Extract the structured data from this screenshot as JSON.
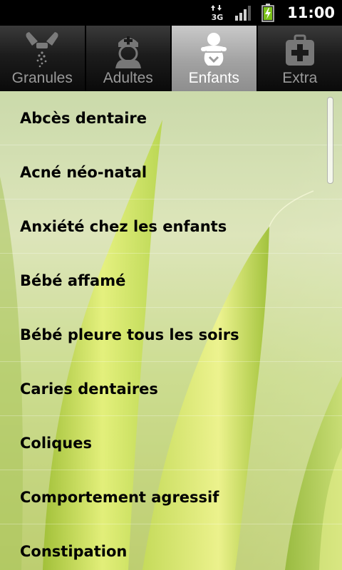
{
  "status_bar": {
    "time": "11:00",
    "network_type": "3G",
    "icons": [
      "data-transfer-icon",
      "signal-strength-icon",
      "battery-charging-icon"
    ]
  },
  "tabs": [
    {
      "label": "Granules",
      "icon": "pills-icon",
      "selected": false
    },
    {
      "label": "Adultes",
      "icon": "nurse-icon",
      "selected": false
    },
    {
      "label": "Enfants",
      "icon": "baby-icon",
      "selected": true
    },
    {
      "label": "Extra",
      "icon": "first-aid-kit-icon",
      "selected": false
    }
  ],
  "list": {
    "items": [
      "Abcès dentaire",
      "Acné néo-natal",
      "Anxiété chez les enfants",
      "Bébé affamé",
      "Bébé pleure tous les soirs",
      "Caries dentaires",
      "Coliques",
      "Comportement agressif",
      "Constipation"
    ]
  },
  "colors": {
    "selected_tab": "#a2a2a2",
    "tab_bar": "#1c1c1c",
    "background_green": "#c8da84"
  }
}
